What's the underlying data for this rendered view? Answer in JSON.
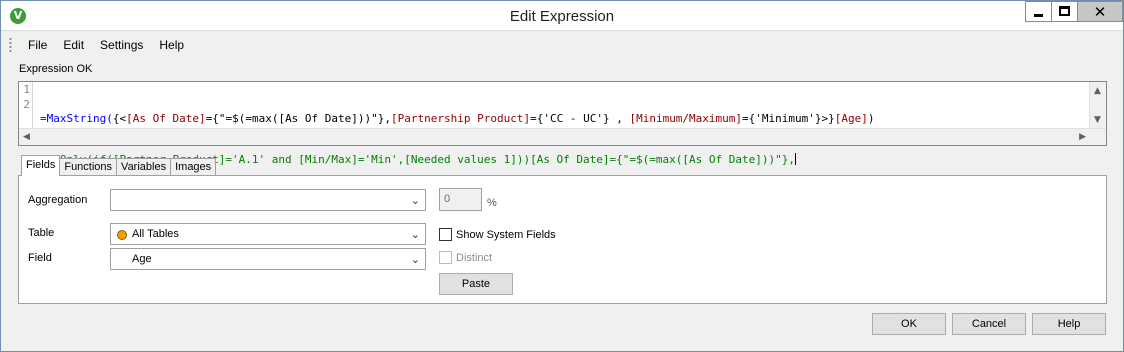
{
  "window": {
    "title": "Edit Expression",
    "app_icon": "V"
  },
  "menu": {
    "items": [
      "File",
      "Edit",
      "Settings",
      "Help"
    ]
  },
  "status": "Expression OK",
  "editor": {
    "line_numbers": [
      "1",
      "2"
    ],
    "line1": {
      "fn": "=MaxString(",
      "p1": "{<",
      "f1": "[As Of Date]",
      "p2": "={\"=$(=max([As Of Date]))\"},",
      "f2": "[Partnership Product]",
      "p3": "={'CC - UC'} , ",
      "f3": "[Minimum/Maximum]",
      "p4": "={'Minimum'}>}",
      "f4": "[Age]",
      "p5": ")"
    },
    "line2": "//=Only(if([Partner Product]='A.1' and [Min/Max]='Min',[Needed values 1]))[As Of Date]={\"=$(=max([As Of Date]))\"},"
  },
  "tabs": [
    "Fields",
    "Functions",
    "Variables",
    "Images"
  ],
  "fields_panel": {
    "aggregation_label": "Aggregation",
    "aggregation_value": "",
    "percent_value": "0",
    "percent_sign": "%",
    "table_label": "Table",
    "table_value": "All Tables",
    "field_label": "Field",
    "field_value": "Age",
    "show_system_fields": "Show System Fields",
    "distinct": "Distinct",
    "paste": "Paste"
  },
  "buttons": {
    "ok": "OK",
    "cancel": "Cancel",
    "help": "Help"
  },
  "colors": {
    "function": "#0000ff",
    "field": "#8b0000",
    "comment": "#008000",
    "table_icon": "#f0a000"
  }
}
